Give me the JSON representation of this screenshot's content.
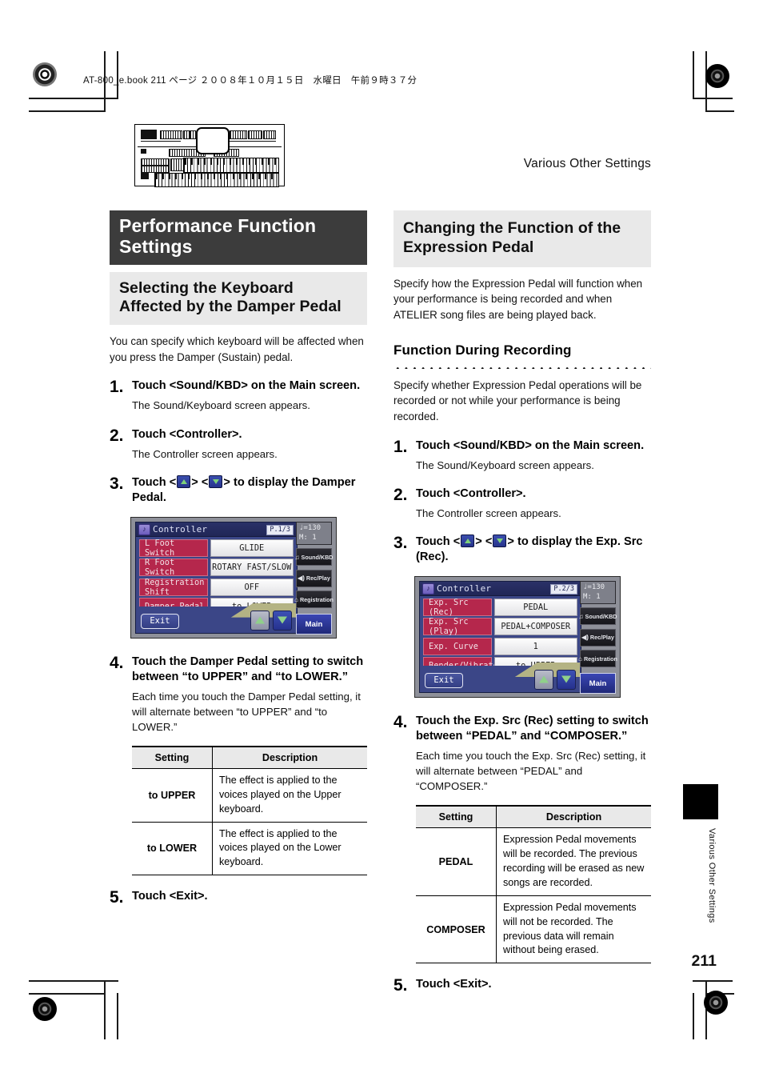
{
  "print": {
    "file_header": "AT-800_e.book  211 ページ  ２００８年１０月１５日　水曜日　午前９時３７分"
  },
  "running_header": "Various Other Settings",
  "thumb_tab_label": "Various Other Settings",
  "page_number": "211",
  "illustration": {
    "name": "atelier-organ-front-panel",
    "highlight": "display-screen"
  },
  "left_column": {
    "h1": "Performance Function Settings",
    "h2": "Selecting the Keyboard Affected by the Damper Pedal",
    "intro": "You can specify which keyboard will be affected when you press the Damper (Sustain) pedal.",
    "steps": [
      {
        "num": "1.",
        "title": "Touch <Sound/KBD> on the Main screen.",
        "desc": "The Sound/Keyboard screen appears."
      },
      {
        "num": "2.",
        "title": "Touch <Controller>.",
        "desc": "The Controller screen appears."
      },
      {
        "num": "3.",
        "title_a": "Touch <",
        "title_b": "> <",
        "title_c": "> to display the Damper Pedal.",
        "desc": ""
      },
      {
        "num": "4.",
        "title": "Touch the Damper Pedal setting to switch between “to UPPER” and “to LOWER.”",
        "desc": "Each time you touch the Damper Pedal setting, it will alternate between “to UPPER” and “to LOWER.”"
      },
      {
        "num": "5.",
        "title": "Touch <Exit>.",
        "desc": ""
      }
    ],
    "table": {
      "headers": [
        "Setting",
        "Description"
      ],
      "rows": [
        {
          "setting": "to UPPER",
          "description": "The effect is applied to the voices played on the Upper keyboard."
        },
        {
          "setting": "to LOWER",
          "description": "The effect is applied to the voices played on the Lower keyboard."
        }
      ]
    },
    "lcd": {
      "title": "Controller",
      "page_badge": "P.1/3",
      "rows": [
        {
          "label": "L Foot Switch",
          "value": "GLIDE"
        },
        {
          "label": "R Foot Switch",
          "value": "ROTARY FAST/SLOW"
        },
        {
          "label": "Registration Shift",
          "value": "OFF"
        },
        {
          "label": "Damper Pedal",
          "value": "to LOWER"
        }
      ],
      "exit_label": "Exit",
      "tempo_line1": "♩=130",
      "tempo_line2": "M:    1",
      "side_buttons": [
        "Sound/KBD",
        "Rec/Play",
        "Registration"
      ],
      "main_label": "Main"
    }
  },
  "right_column": {
    "h2": "Changing the Function of the Expression Pedal",
    "intro": "Specify how the Expression Pedal will function when your performance is being recorded and when ATELIER song files are being played back.",
    "h3": "Function During Recording",
    "intro2": "Specify whether Expression Pedal operations will be recorded or not while your performance is being recorded.",
    "steps": [
      {
        "num": "1.",
        "title": "Touch <Sound/KBD> on the Main screen.",
        "desc": "The Sound/Keyboard screen appears."
      },
      {
        "num": "2.",
        "title": "Touch <Controller>.",
        "desc": "The Controller screen appears."
      },
      {
        "num": "3.",
        "title_a": "Touch <",
        "title_b": "> <",
        "title_c": "> to display the Exp. Src (Rec).",
        "desc": ""
      },
      {
        "num": "4.",
        "title": "Touch the Exp. Src (Rec) setting to switch between “PEDAL” and “COMPOSER.”",
        "desc": "Each time you touch the Exp. Src (Rec) setting, it will alternate between “PEDAL” and “COMPOSER.”"
      },
      {
        "num": "5.",
        "title": "Touch <Exit>.",
        "desc": ""
      }
    ],
    "table": {
      "headers": [
        "Setting",
        "Description"
      ],
      "rows": [
        {
          "setting": "PEDAL",
          "description": "Expression Pedal movements will be recorded. The previous recording will be erased as new songs are recorded."
        },
        {
          "setting": "COMPOSER",
          "description": "Expression Pedal movements will not be recorded. The previous data will remain without being erased."
        }
      ]
    },
    "lcd": {
      "title": "Controller",
      "page_badge": "P.2/3",
      "rows": [
        {
          "label": "Exp. Src (Rec)",
          "value": "PEDAL"
        },
        {
          "label": "Exp. Src (Play)",
          "value": "PEDAL+COMPOSER"
        },
        {
          "label": "Exp. Curve",
          "value": "1"
        },
        {
          "label": "Bender/Vibrato",
          "value": "to UPPER"
        }
      ],
      "exit_label": "Exit",
      "tempo_line1": "♩=130",
      "tempo_line2": "M:    1",
      "side_buttons": [
        "Sound/KBD",
        "Rec/Play",
        "Registration"
      ],
      "main_label": "Main"
    }
  },
  "colors": {
    "h1_bar": "#3c3c3c",
    "h2_bar": "#e9e9e9",
    "lcd_bg": "#3b4687",
    "lcd_label": "#b5274c",
    "lcd_main_button": "#2a35a0",
    "arrow_green": "#8fd08a"
  }
}
